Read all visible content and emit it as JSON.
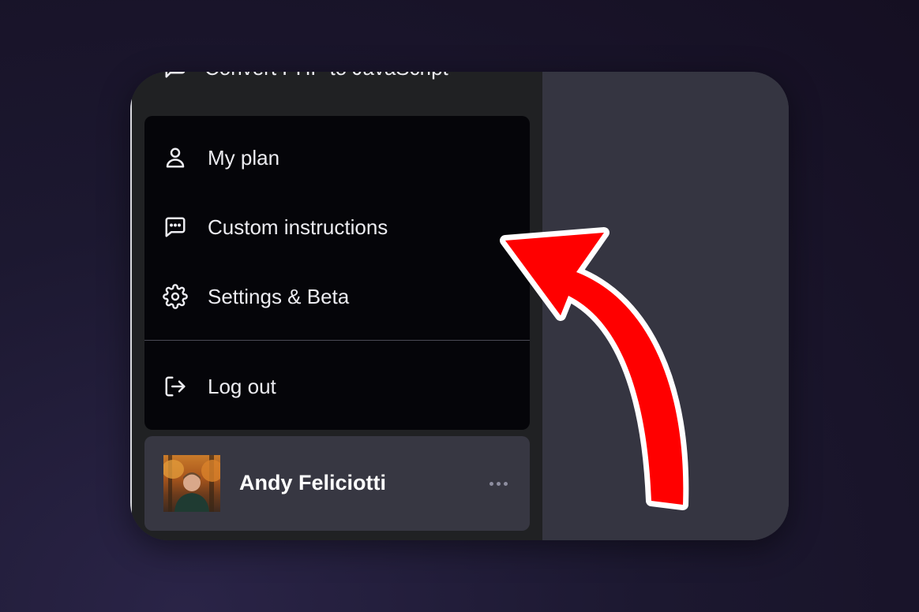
{
  "sidebar": {
    "history_item": {
      "label": "Convert PHP to JavaScript",
      "icon": "chat-bubble-icon"
    }
  },
  "menu": {
    "items": [
      {
        "label": "My plan",
        "icon": "user-icon"
      },
      {
        "label": "Custom instructions",
        "icon": "message-dots-icon"
      },
      {
        "label": "Settings & Beta",
        "icon": "gear-icon"
      },
      {
        "label": "Log out",
        "icon": "logout-icon"
      }
    ]
  },
  "user": {
    "name": "Andy Feliciotti",
    "more_icon": "ellipsis-icon"
  },
  "annotation": {
    "arrow_color": "#ff0000",
    "arrow_outline": "#ffffff"
  },
  "colors": {
    "sidebar_bg": "#202123",
    "menu_bg": "#050509",
    "main_bg": "#353541",
    "text": "#ececf1"
  }
}
